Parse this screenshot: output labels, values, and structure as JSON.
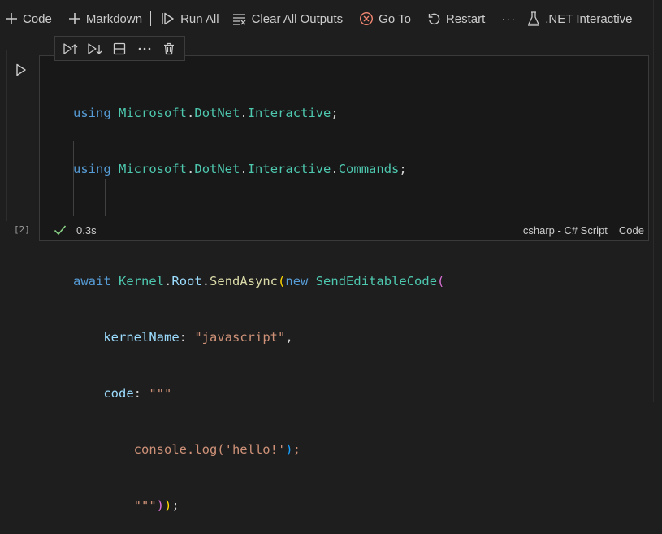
{
  "toolbar": {
    "code_label": "Code",
    "markdown_label": "Markdown",
    "run_all_label": "Run All",
    "clear_outputs_label": "Clear All Outputs",
    "goto_label": "Go To",
    "restart_label": "Restart",
    "more_label": "···",
    "kernel_label": ".NET Interactive"
  },
  "cell_toolbar": {
    "icons": [
      "execute-above-icon",
      "execute-below-icon",
      "split-cell-icon",
      "more-icon",
      "trash-icon"
    ]
  },
  "cell": {
    "execution_count": "[2]",
    "duration": "0.3s",
    "language": "csharp - C# Script",
    "cell_type": "Code",
    "code": {
      "l1": [
        "using",
        "Microsoft",
        ".",
        "DotNet",
        ".",
        "Interactive",
        ";"
      ],
      "l2": [
        "using",
        "Microsoft",
        ".",
        "DotNet",
        ".",
        "Interactive",
        ".",
        "Commands",
        ";"
      ],
      "l4": [
        "await",
        "Kernel",
        ".",
        "Root",
        ".",
        "SendAsync",
        "(",
        "new",
        "SendEditableCode",
        "("
      ],
      "l5": [
        "kernelName",
        ": ",
        "\"javascript\"",
        ","
      ],
      "l6": [
        "code",
        ": ",
        "\"\"\""
      ],
      "l7": [
        "console.log(",
        "'hello!'",
        ")",
        ";"
      ],
      "l8": [
        "\"\"\"",
        ")",
        ")",
        ";"
      ]
    }
  },
  "colors": {
    "background": "#1e1e1e",
    "keyword": "#569cd6",
    "type": "#4ec9b0",
    "string": "#ce9178",
    "function": "#dcdcaa",
    "property": "#9cdcfe",
    "success": "#89d185",
    "goto_icon": "#f48771"
  }
}
